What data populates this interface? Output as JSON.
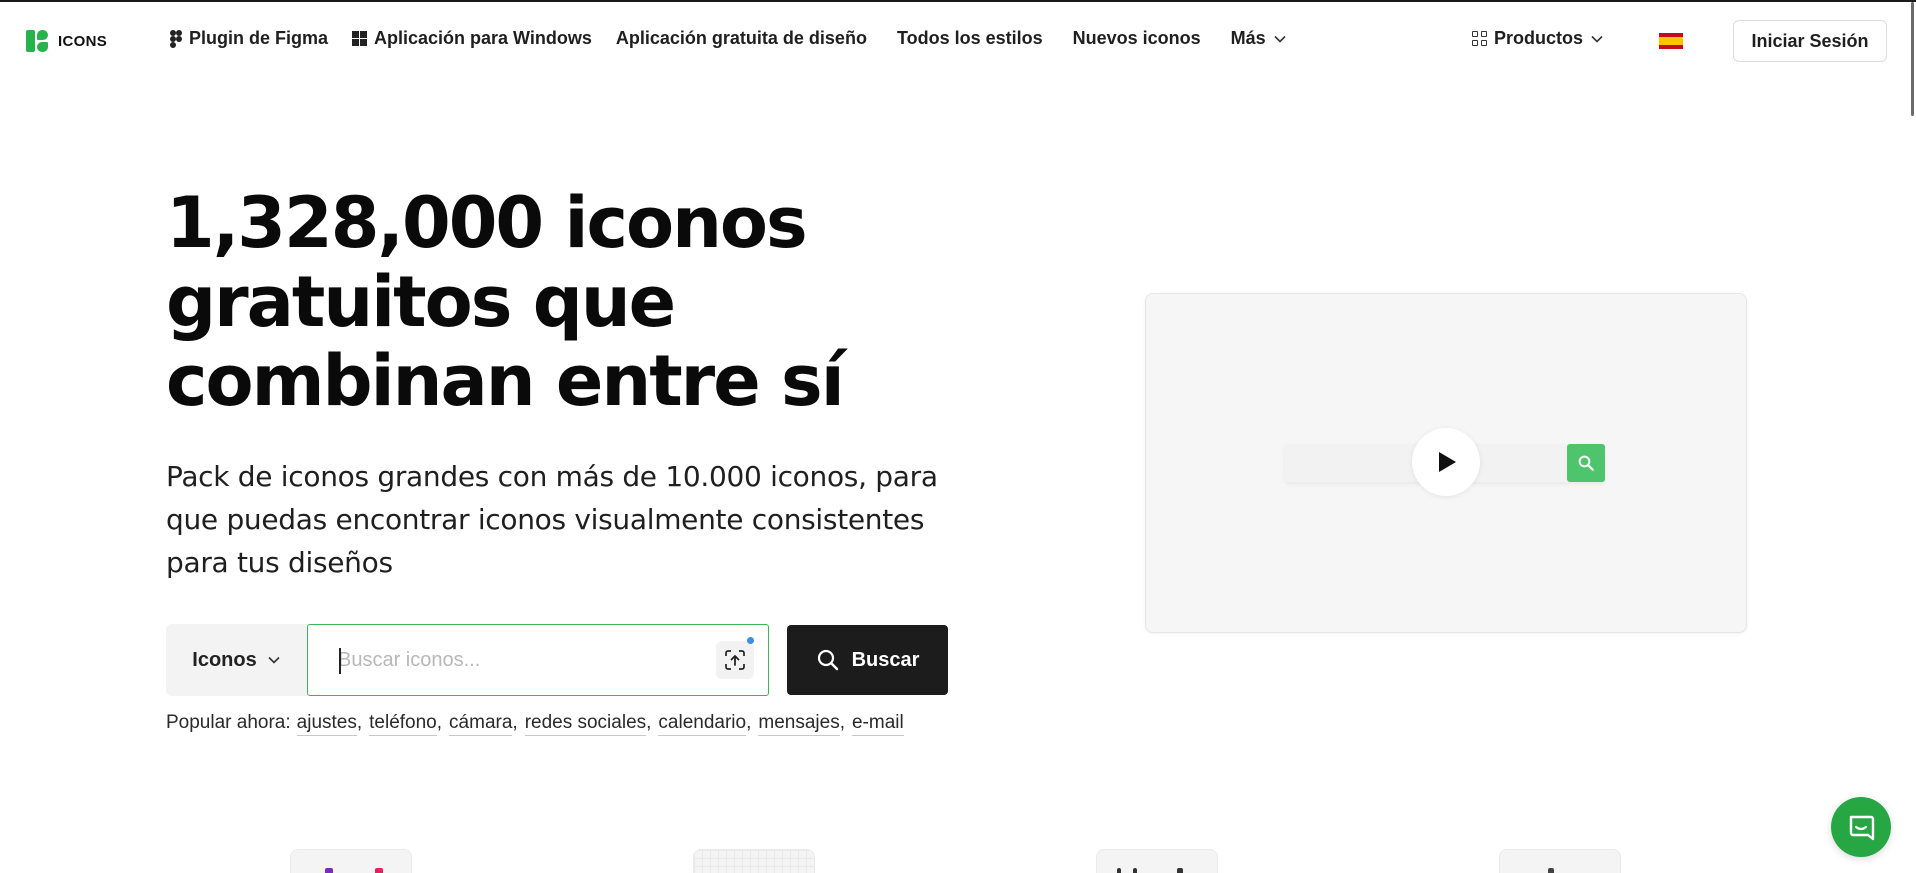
{
  "header": {
    "logo_text": "ICONS",
    "nav": [
      {
        "label": "Plugin de Figma",
        "icon": "figma-icon"
      },
      {
        "label": "Aplicación para Windows",
        "icon": "windows-icon"
      },
      {
        "label": "Aplicación gratuita de diseño"
      },
      {
        "label": "Todos los estilos"
      },
      {
        "label": "Nuevos iconos"
      },
      {
        "label": "Más",
        "icon": "chevron-down-icon"
      }
    ],
    "productos_label": "Productos",
    "language_flag": "spain-flag",
    "login_label": "Iniciar Sesión"
  },
  "hero": {
    "title_lines": [
      "1,328,000 iconos",
      "gratuitos que",
      "combinan entre sí"
    ],
    "subtitle_lines": [
      "Pack de iconos grandes con más de 10.000 iconos, para",
      "que puedas encontrar iconos visualmente consistentes",
      "para tus diseños"
    ]
  },
  "search": {
    "type_selected": "Iconos",
    "input_value": "",
    "placeholder": "Buscar iconos...",
    "button_label": "Buscar"
  },
  "popular": {
    "label": "Popular ahora:",
    "items": [
      "ajustes",
      "teléfono",
      "cámara",
      "redes sociales",
      "calendario",
      "mensajes",
      "e-mail"
    ]
  },
  "colors": {
    "brand_green": "#27b34a",
    "search_border": "#3cb55a",
    "dark_button": "#1c1c1c",
    "video_search_button": "#4ec56c",
    "chat_button": "#27a744"
  }
}
